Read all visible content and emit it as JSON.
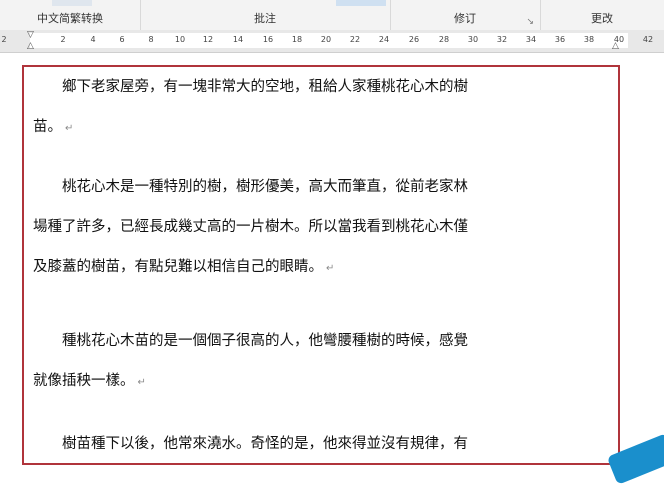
{
  "ribbon": {
    "groups": [
      {
        "label": "中文简繁转换"
      },
      {
        "label": "批注"
      },
      {
        "label": "修订"
      },
      {
        "label": "更改"
      }
    ]
  },
  "ruler": {
    "numbers": [
      "2",
      "2",
      "4",
      "6",
      "8",
      "10",
      "12",
      "14",
      "16",
      "18",
      "20",
      "22",
      "24",
      "26",
      "28",
      "30",
      "32",
      "34",
      "36",
      "38",
      "40",
      "42"
    ]
  },
  "document": {
    "paragraph_mark": "↵",
    "paragraphs": [
      {
        "lines": [
          "鄉下老家屋旁，有一塊非常大的空地，租給人家種桃花心木的樹",
          "苗。"
        ]
      },
      {
        "lines": [
          "桃花心木是一種特別的樹，樹形優美，高大而筆直，從前老家林",
          "場種了許多，已經長成幾丈高的一片樹木。所以當我看到桃花心木僅",
          "及膝蓋的樹苗，有點兒難以相信自己的眼睛。"
        ]
      },
      {
        "lines": [
          "種桃花心木苗的是一個個子很高的人，他彎腰種樹的時候，感覺",
          "就像插秧一樣。"
        ]
      },
      {
        "lines": [
          "樹苗種下以後，他常來澆水。奇怪的是，他來得並沒有規律，有"
        ]
      }
    ]
  },
  "colors": {
    "selection_border": "#b0343b",
    "corner_accent": "#1a8fcc"
  }
}
